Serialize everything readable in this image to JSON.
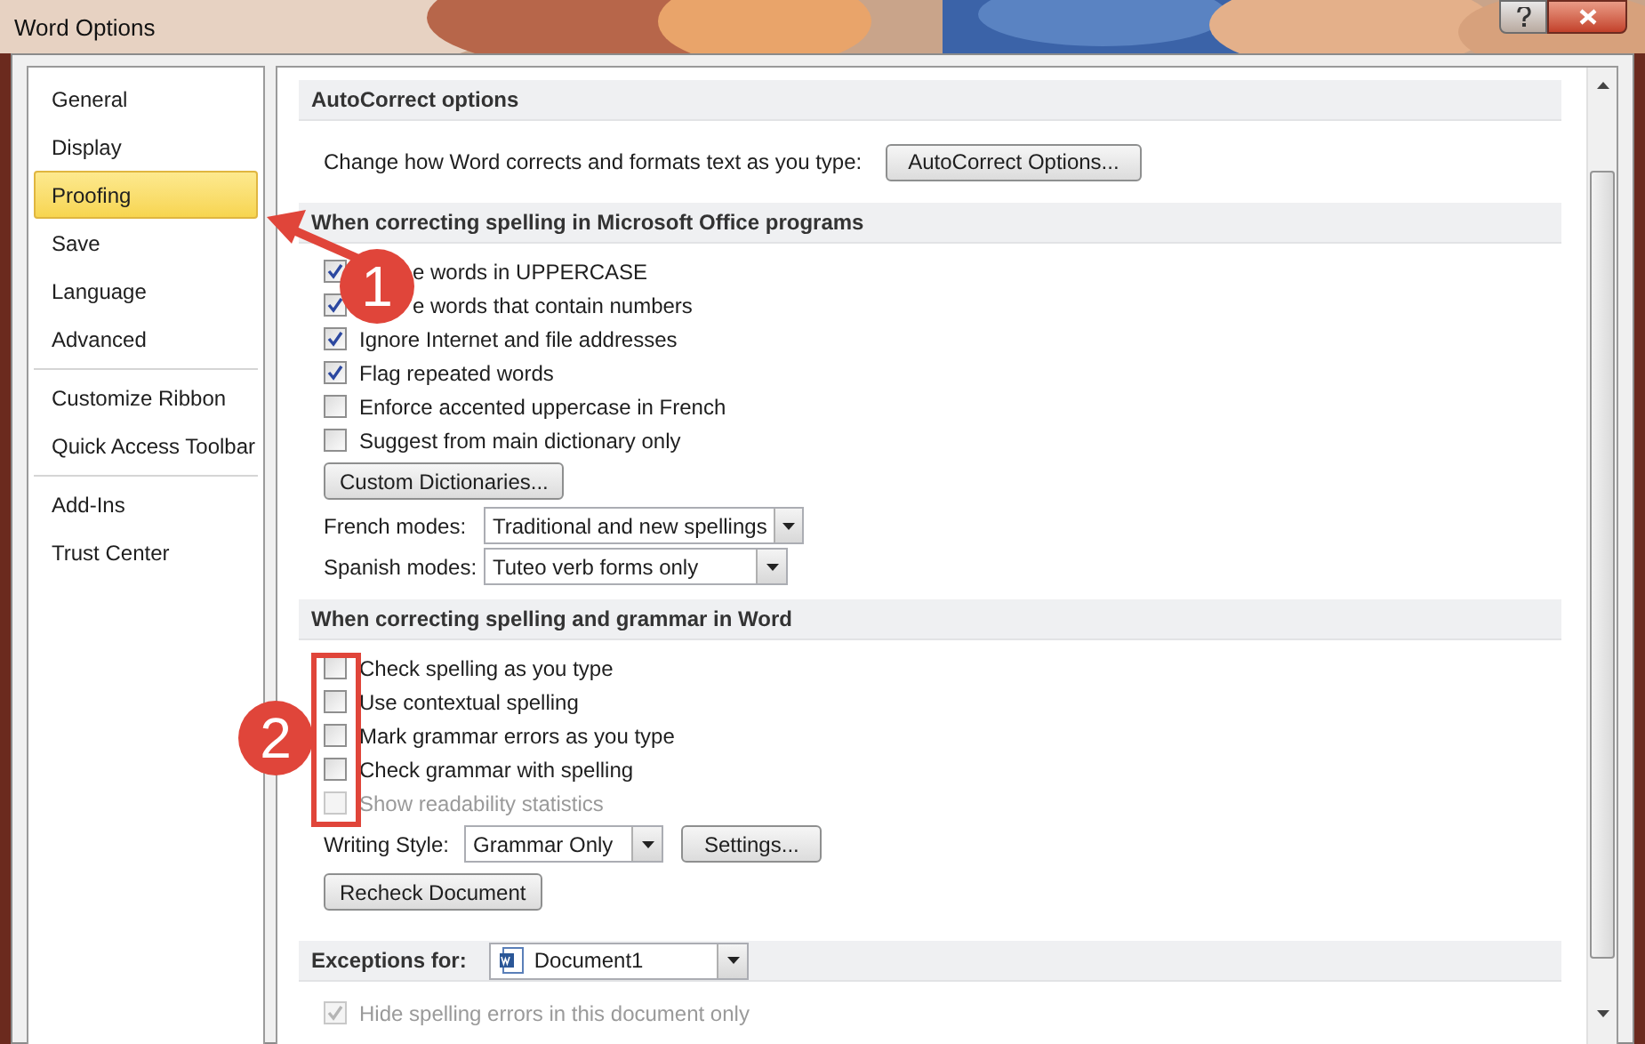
{
  "window": {
    "title": "Word Options"
  },
  "sidebar": {
    "groups": [
      [
        {
          "label": "General",
          "selected": false
        },
        {
          "label": "Display",
          "selected": false
        },
        {
          "label": "Proofing",
          "selected": true
        },
        {
          "label": "Save",
          "selected": false
        },
        {
          "label": "Language",
          "selected": false
        },
        {
          "label": "Advanced",
          "selected": false
        }
      ],
      [
        {
          "label": "Customize Ribbon",
          "selected": false
        },
        {
          "label": "Quick Access Toolbar",
          "selected": false
        }
      ],
      [
        {
          "label": "Add-Ins",
          "selected": false
        },
        {
          "label": "Trust Center",
          "selected": false
        }
      ]
    ]
  },
  "sections": [
    {
      "title": "AutoCorrect options",
      "rows": [
        {
          "kind": "label_button",
          "label": "Change how Word corrects and formats text as you type:",
          "button": "AutoCorrect Options..."
        }
      ]
    },
    {
      "title": "When correcting spelling in Microsoft Office programs",
      "rows": [
        {
          "kind": "covered_checkbox",
          "label": "e words in UPPERCASE",
          "checked": true,
          "disabled": false
        },
        {
          "kind": "covered_checkbox",
          "label": "e words that contain numbers",
          "checked": true,
          "disabled": false
        },
        {
          "kind": "checkbox",
          "label": "Ignore Internet and file addresses",
          "checked": true,
          "disabled": false
        },
        {
          "kind": "checkbox",
          "label": "Flag repeated words",
          "checked": true,
          "disabled": false
        },
        {
          "kind": "checkbox",
          "label": "Enforce accented uppercase in French",
          "checked": false,
          "disabled": false
        },
        {
          "kind": "checkbox",
          "label": "Suggest from main dictionary only",
          "checked": false,
          "disabled": false
        },
        {
          "kind": "button",
          "label": "Custom Dictionaries..."
        },
        {
          "kind": "dropdown",
          "label": "French modes:",
          "value": "Traditional and new spellings"
        },
        {
          "kind": "dropdown",
          "label": "Spanish modes:",
          "value": "Tuteo verb forms only"
        }
      ]
    },
    {
      "title": "When correcting spelling and grammar in Word",
      "rows": [
        {
          "kind": "checkbox",
          "label": "Check spelling as you type",
          "checked": false,
          "disabled": false
        },
        {
          "kind": "checkbox",
          "label": "Use contextual spelling",
          "checked": false,
          "disabled": false
        },
        {
          "kind": "checkbox",
          "label": "Mark grammar errors as you type",
          "checked": false,
          "disabled": false
        },
        {
          "kind": "checkbox",
          "label": "Check grammar with spelling",
          "checked": false,
          "disabled": false
        },
        {
          "kind": "checkbox",
          "label": "Show readability statistics",
          "checked": false,
          "disabled": true
        },
        {
          "kind": "dropdown_button",
          "label": "Writing Style:",
          "value": "Grammar Only",
          "button": "Settings..."
        },
        {
          "kind": "button",
          "label": "Recheck Document"
        }
      ]
    },
    {
      "title": "Exceptions for:",
      "dropdown": "Document1",
      "rows": [
        {
          "kind": "checkbox",
          "label": "Hide spelling errors in this document only",
          "checked": true,
          "disabled": true
        }
      ]
    }
  ],
  "annotations": [
    {
      "kind": "callout",
      "text": "1"
    },
    {
      "kind": "callout",
      "text": "2"
    }
  ]
}
